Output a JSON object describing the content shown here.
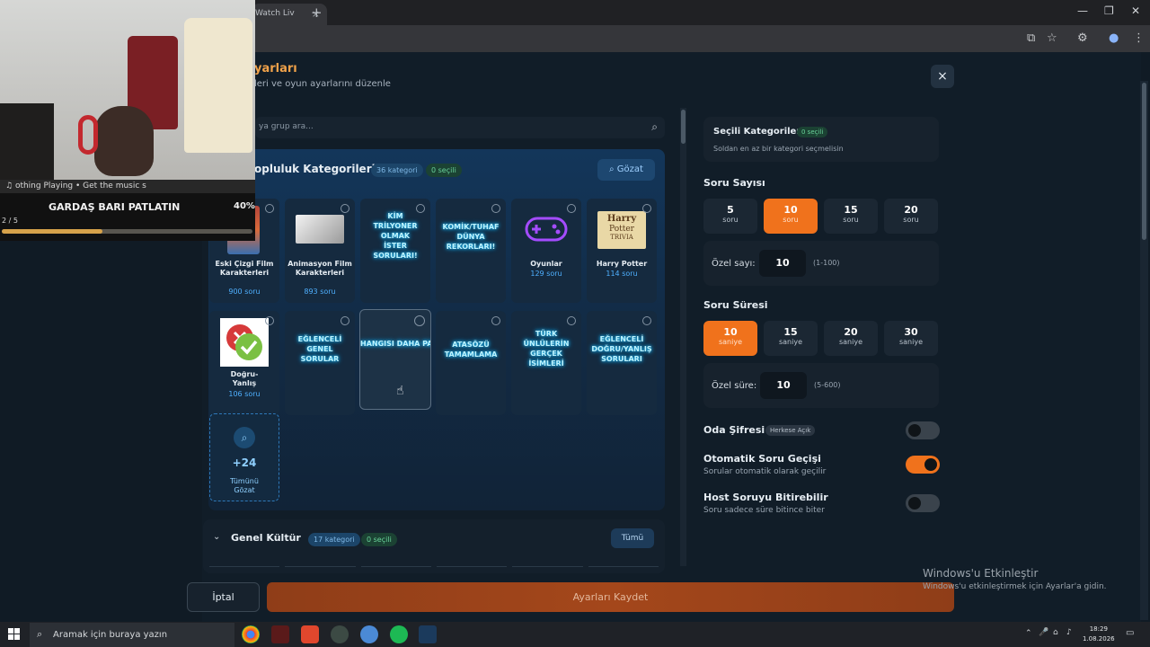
{
  "browser": {
    "tab_title": "Watch Liv",
    "tab_close": "×",
    "new_tab": "+",
    "win_minimize": "—",
    "win_restore": "❐",
    "win_close": "✕"
  },
  "dialog": {
    "title": "yarları",
    "subtitle": "leri ve oyun ayarlarını düzenle",
    "close_label": "×",
    "search_placeholder": "ya grup ara..."
  },
  "community": {
    "title": "opluluk Kategorileri",
    "category_count": "36 kategori",
    "selected_count": "0 seçili",
    "browse_label": "Gözat",
    "cards": [
      {
        "name": "Eski Çizgi Film Karakterleri",
        "count": "900 soru"
      },
      {
        "name": "Animasyon Film Karakterleri",
        "count": "893 soru"
      },
      {
        "name": "KİM TRİLYONER OLMAK İSTER SORULARI!",
        "count": ""
      },
      {
        "name": "KOMİK/TUHAF DÜNYA REKORLARI!",
        "count": ""
      },
      {
        "name": "Oyunlar",
        "count": "129 soru"
      },
      {
        "name": "Harry Potter",
        "count": "114 soru"
      },
      {
        "name": "Doğru-Yanlış",
        "count": "106 soru"
      },
      {
        "name": "EĞLENCELİ GENEL SORULAR",
        "count": ""
      },
      {
        "name": "HANGISI DAHA PAHALI/BÜYÜK/VE",
        "count": ""
      },
      {
        "name": "ATASÖZÜ TAMAMLAMA",
        "count": ""
      },
      {
        "name": "TÜRK ÜNLÜLERİN GERÇEK İSİMLERİ",
        "count": ""
      },
      {
        "name": "EĞLENCELİ DOĞRU/YANLIŞ SORULARI",
        "count": ""
      }
    ],
    "harry_logo_line1": "Harry",
    "harry_logo_line2": "Potter",
    "harry_logo_line3": "TRIVIA",
    "more_count": "+24",
    "more_label": "Tümünü Gözat"
  },
  "general": {
    "title": "Genel Kültür",
    "category_count": "17 kategori",
    "selected_count": "0 seçili",
    "all_label": "Tümü"
  },
  "settings": {
    "selected_title": "Seçili Kategoriler",
    "selected_badge": "0 seçili",
    "selected_hint": "Soldan en az bir kategori seçmelisin",
    "question_count_label": "Soru Sayısı",
    "question_count_options": [
      {
        "n": "5",
        "u": "soru"
      },
      {
        "n": "10",
        "u": "soru"
      },
      {
        "n": "15",
        "u": "soru"
      },
      {
        "n": "20",
        "u": "soru"
      }
    ],
    "question_count_selected": "10",
    "custom_count_label": "Özel sayı:",
    "custom_count_value": "10",
    "custom_count_range": "(1-100)",
    "question_time_label": "Soru Süresi",
    "question_time_options": [
      {
        "n": "10",
        "u": "saniye"
      },
      {
        "n": "15",
        "u": "saniye"
      },
      {
        "n": "20",
        "u": "saniye"
      },
      {
        "n": "30",
        "u": "saniye"
      }
    ],
    "question_time_selected": "10",
    "custom_time_label": "Özel süre:",
    "custom_time_value": "10",
    "custom_time_range": "(5-600)",
    "room_password_label": "Oda Şifresi",
    "room_password_badge": "Herkese Açık",
    "room_password_on": false,
    "auto_next_label": "Otomatik Soru Geçişi",
    "auto_next_hint": "Sorular otomatik olarak geçilir",
    "auto_next_on": true,
    "host_finish_label": "Host Soruyu Bitirebilir",
    "host_finish_hint": "Soru sadece süre bitince biter",
    "host_finish_on": false
  },
  "footer": {
    "cancel_label": "İptal",
    "save_label": "Ayarları Kaydet"
  },
  "windows": {
    "activate_title": "Windows'u Etkinleştir",
    "activate_hint": "Windows'u etkinleştirmek için Ayarlar'a gidin.",
    "search_placeholder": "Aramak için buraya yazın",
    "time": "18:29",
    "date": "1.08.2026"
  },
  "stream_overlay": {
    "now_playing": "othing Playing  •  Get the music s",
    "title": "GARDAŞ BARI PATLATIN",
    "percent": "40%",
    "progress": 0.4,
    "count": "2 / 5"
  },
  "colors": {
    "accent": "#f0721c",
    "panel": "#17222d",
    "link": "#4fb0ff"
  }
}
